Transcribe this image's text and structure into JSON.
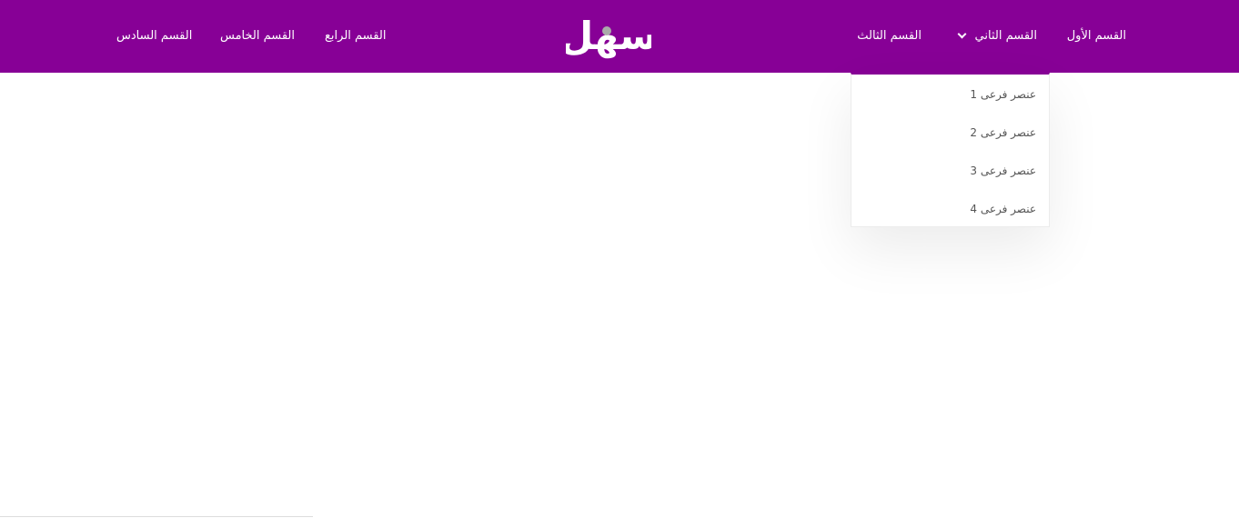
{
  "brand": {
    "logo_text": "سهل",
    "color": "#870096"
  },
  "nav": {
    "items": [
      {
        "label": "القسم الأول"
      },
      {
        "label": "القسم الثاني",
        "has_dropdown": true,
        "icon": "chevron-down-icon",
        "expanded": true
      },
      {
        "label": "القسم الثالث"
      },
      {
        "label": "القسم الرابع"
      },
      {
        "label": "القسم الخامس"
      },
      {
        "label": "القسم السادس"
      }
    ]
  },
  "dropdown": {
    "items": [
      {
        "label": "عنصر فرعى 1"
      },
      {
        "label": "عنصر فرعى 2"
      },
      {
        "label": "عنصر فرعى 3"
      },
      {
        "label": "عنصر فرعى 4"
      }
    ]
  }
}
